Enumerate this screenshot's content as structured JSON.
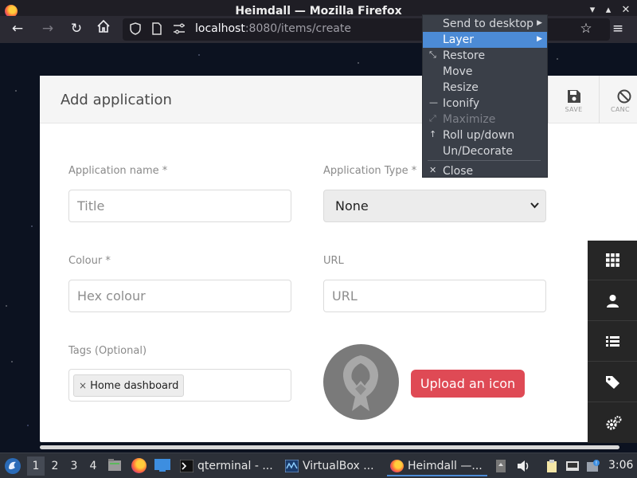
{
  "window": {
    "title": "Heimdall — Mozilla Firefox"
  },
  "nav": {
    "url_host": "localhost",
    "url_rest": ":8080/items/create"
  },
  "card": {
    "title": "Add application",
    "save_label": "SAVE",
    "cancel_label": "CANC"
  },
  "form": {
    "app_name_label": "Application name *",
    "app_name_placeholder": "Title",
    "app_type_label": "Application Type *",
    "app_type_value": "None",
    "colour_label": "Colour *",
    "colour_placeholder": "Hex colour",
    "url_label": "URL",
    "url_placeholder": "URL",
    "tags_label": "Tags (Optional)",
    "tag_value": "Home dashboard",
    "upload_label": "Upload an icon"
  },
  "menu": {
    "items": [
      {
        "label": "Send to desktop",
        "icon": "",
        "submenu": true,
        "state": "normal"
      },
      {
        "label": "Layer",
        "icon": "",
        "submenu": true,
        "state": "highlighted"
      },
      {
        "label": "Restore",
        "icon": "restore-icon",
        "submenu": false,
        "state": "normal"
      },
      {
        "label": "Move",
        "icon": "",
        "submenu": false,
        "state": "normal"
      },
      {
        "label": "Resize",
        "icon": "",
        "submenu": false,
        "state": "normal"
      },
      {
        "label": "Iconify",
        "icon": "iconify-icon",
        "submenu": false,
        "state": "normal"
      },
      {
        "label": "Maximize",
        "icon": "maximize-icon",
        "submenu": false,
        "state": "disabled"
      },
      {
        "label": "Roll up/down",
        "icon": "rollup-icon",
        "submenu": false,
        "state": "normal"
      },
      {
        "label": "Un/Decorate",
        "icon": "",
        "submenu": false,
        "state": "normal"
      },
      {
        "label": "Close",
        "icon": "close-icon",
        "submenu": false,
        "state": "normal"
      }
    ]
  },
  "taskbar": {
    "workspaces": [
      "1",
      "2",
      "3",
      "4"
    ],
    "tasks": [
      "qterminal - ...",
      "VirtualBox ...",
      "Heimdall —..."
    ],
    "clock": "3:06"
  },
  "colors": {
    "accent": "#4c8bd6",
    "upload_button": "#df4a55",
    "sidebar": "#262626"
  }
}
